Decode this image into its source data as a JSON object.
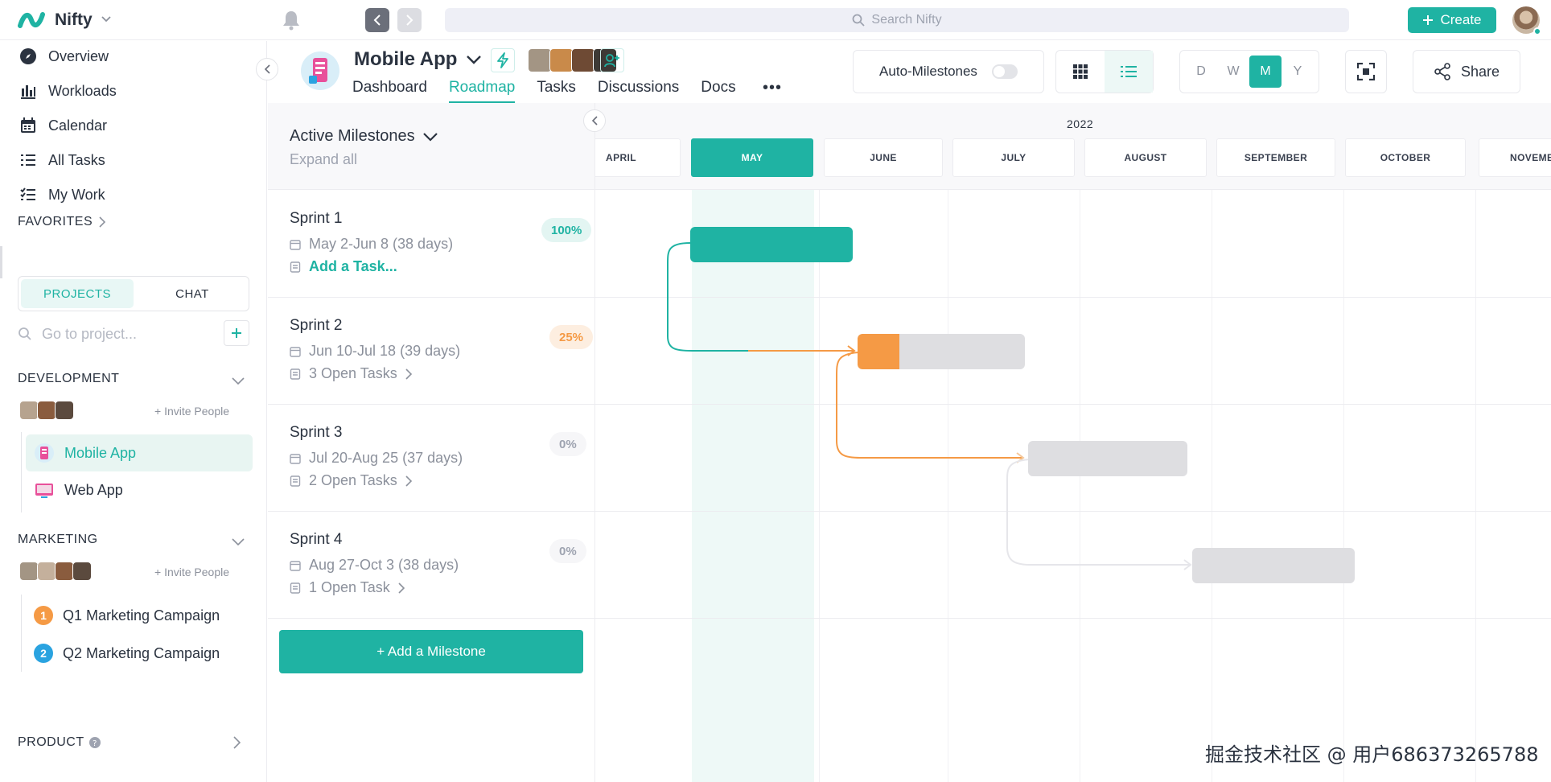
{
  "app": {
    "name": "Nifty"
  },
  "search": {
    "placeholder": "Search Nifty"
  },
  "header": {
    "create_label": "Create"
  },
  "sidebar": {
    "nav": [
      {
        "label": "Overview",
        "icon": "compass-icon"
      },
      {
        "label": "Workloads",
        "icon": "bar-chart-icon"
      },
      {
        "label": "Calendar",
        "icon": "calendar-icon"
      },
      {
        "label": "All Tasks",
        "icon": "list-icon"
      },
      {
        "label": "My Work",
        "icon": "checklist-icon"
      }
    ],
    "favorites_label": "FAVORITES",
    "tabs": [
      {
        "label": "PROJECTS",
        "active": true
      },
      {
        "label": "CHAT",
        "active": false
      }
    ],
    "project_search_placeholder": "Go to project...",
    "groups": [
      {
        "name": "DEVELOPMENT",
        "invite_label": "+ Invite People",
        "projects": [
          {
            "name": "Mobile App",
            "active": true
          },
          {
            "name": "Web App",
            "active": false
          }
        ]
      },
      {
        "name": "MARKETING",
        "invite_label": "+ Invite People",
        "projects": [
          {
            "name": "Q1 Marketing Campaign",
            "badge": "1",
            "badge_color": "#f59a45"
          },
          {
            "name": "Q2 Marketing Campaign",
            "badge": "2",
            "badge_color": "#2aa3e0"
          }
        ]
      }
    ],
    "product_label": "PRODUCT"
  },
  "project": {
    "title": "Mobile App",
    "tabs": [
      {
        "label": "Dashboard",
        "active": false
      },
      {
        "label": "Roadmap",
        "active": true
      },
      {
        "label": "Tasks",
        "active": false
      },
      {
        "label": "Discussions",
        "active": false
      },
      {
        "label": "Docs",
        "active": false
      }
    ],
    "more_label": "•••",
    "auto_milestones_label": "Auto-Milestones",
    "auto_milestones_on": false,
    "scale_options": [
      "D",
      "W",
      "M",
      "Y"
    ],
    "scale_selected": "M",
    "share_label": "Share"
  },
  "milestones": {
    "header": "Active Milestones",
    "expand_all": "Expand all",
    "items": [
      {
        "name": "Sprint 1",
        "dates": "May 2-Jun 8 (38 days)",
        "tasks": "Add a Task...",
        "percent": "100%",
        "pct_color": "#1fb3a3",
        "pct_bg": "#e3f5f2"
      },
      {
        "name": "Sprint 2",
        "dates": "Jun 10-Jul 18 (39 days)",
        "tasks": "3 Open Tasks",
        "percent": "25%",
        "pct_color": "#f59a45",
        "pct_bg": "#fdeee0"
      },
      {
        "name": "Sprint 3",
        "dates": "Jul 20-Aug 25 (37 days)",
        "tasks": "2 Open Tasks",
        "percent": "0%",
        "pct_color": "#9ea3b0",
        "pct_bg": "#f6f6f8"
      },
      {
        "name": "Sprint 4",
        "dates": "Aug 27-Oct 3 (38 days)",
        "tasks": "1 Open Task",
        "percent": "0%",
        "pct_color": "#9ea3b0",
        "pct_bg": "#f6f6f8"
      }
    ],
    "add_label": "+ Add a Milestone"
  },
  "timeline": {
    "year": "2022",
    "months": [
      "APRIL",
      "MAY",
      "JUNE",
      "JULY",
      "AUGUST",
      "SEPTEMBER",
      "OCTOBER",
      "NOVEMBER"
    ],
    "current_month": "MAY",
    "progress": [
      1.0,
      0.25,
      0.0,
      0.0
    ]
  },
  "colors": {
    "accent": "#1fb3a3",
    "orange": "#f59a45",
    "bar_pending": "#dedee1"
  },
  "watermark": "掘金技术社区 @ 用户686373265788"
}
